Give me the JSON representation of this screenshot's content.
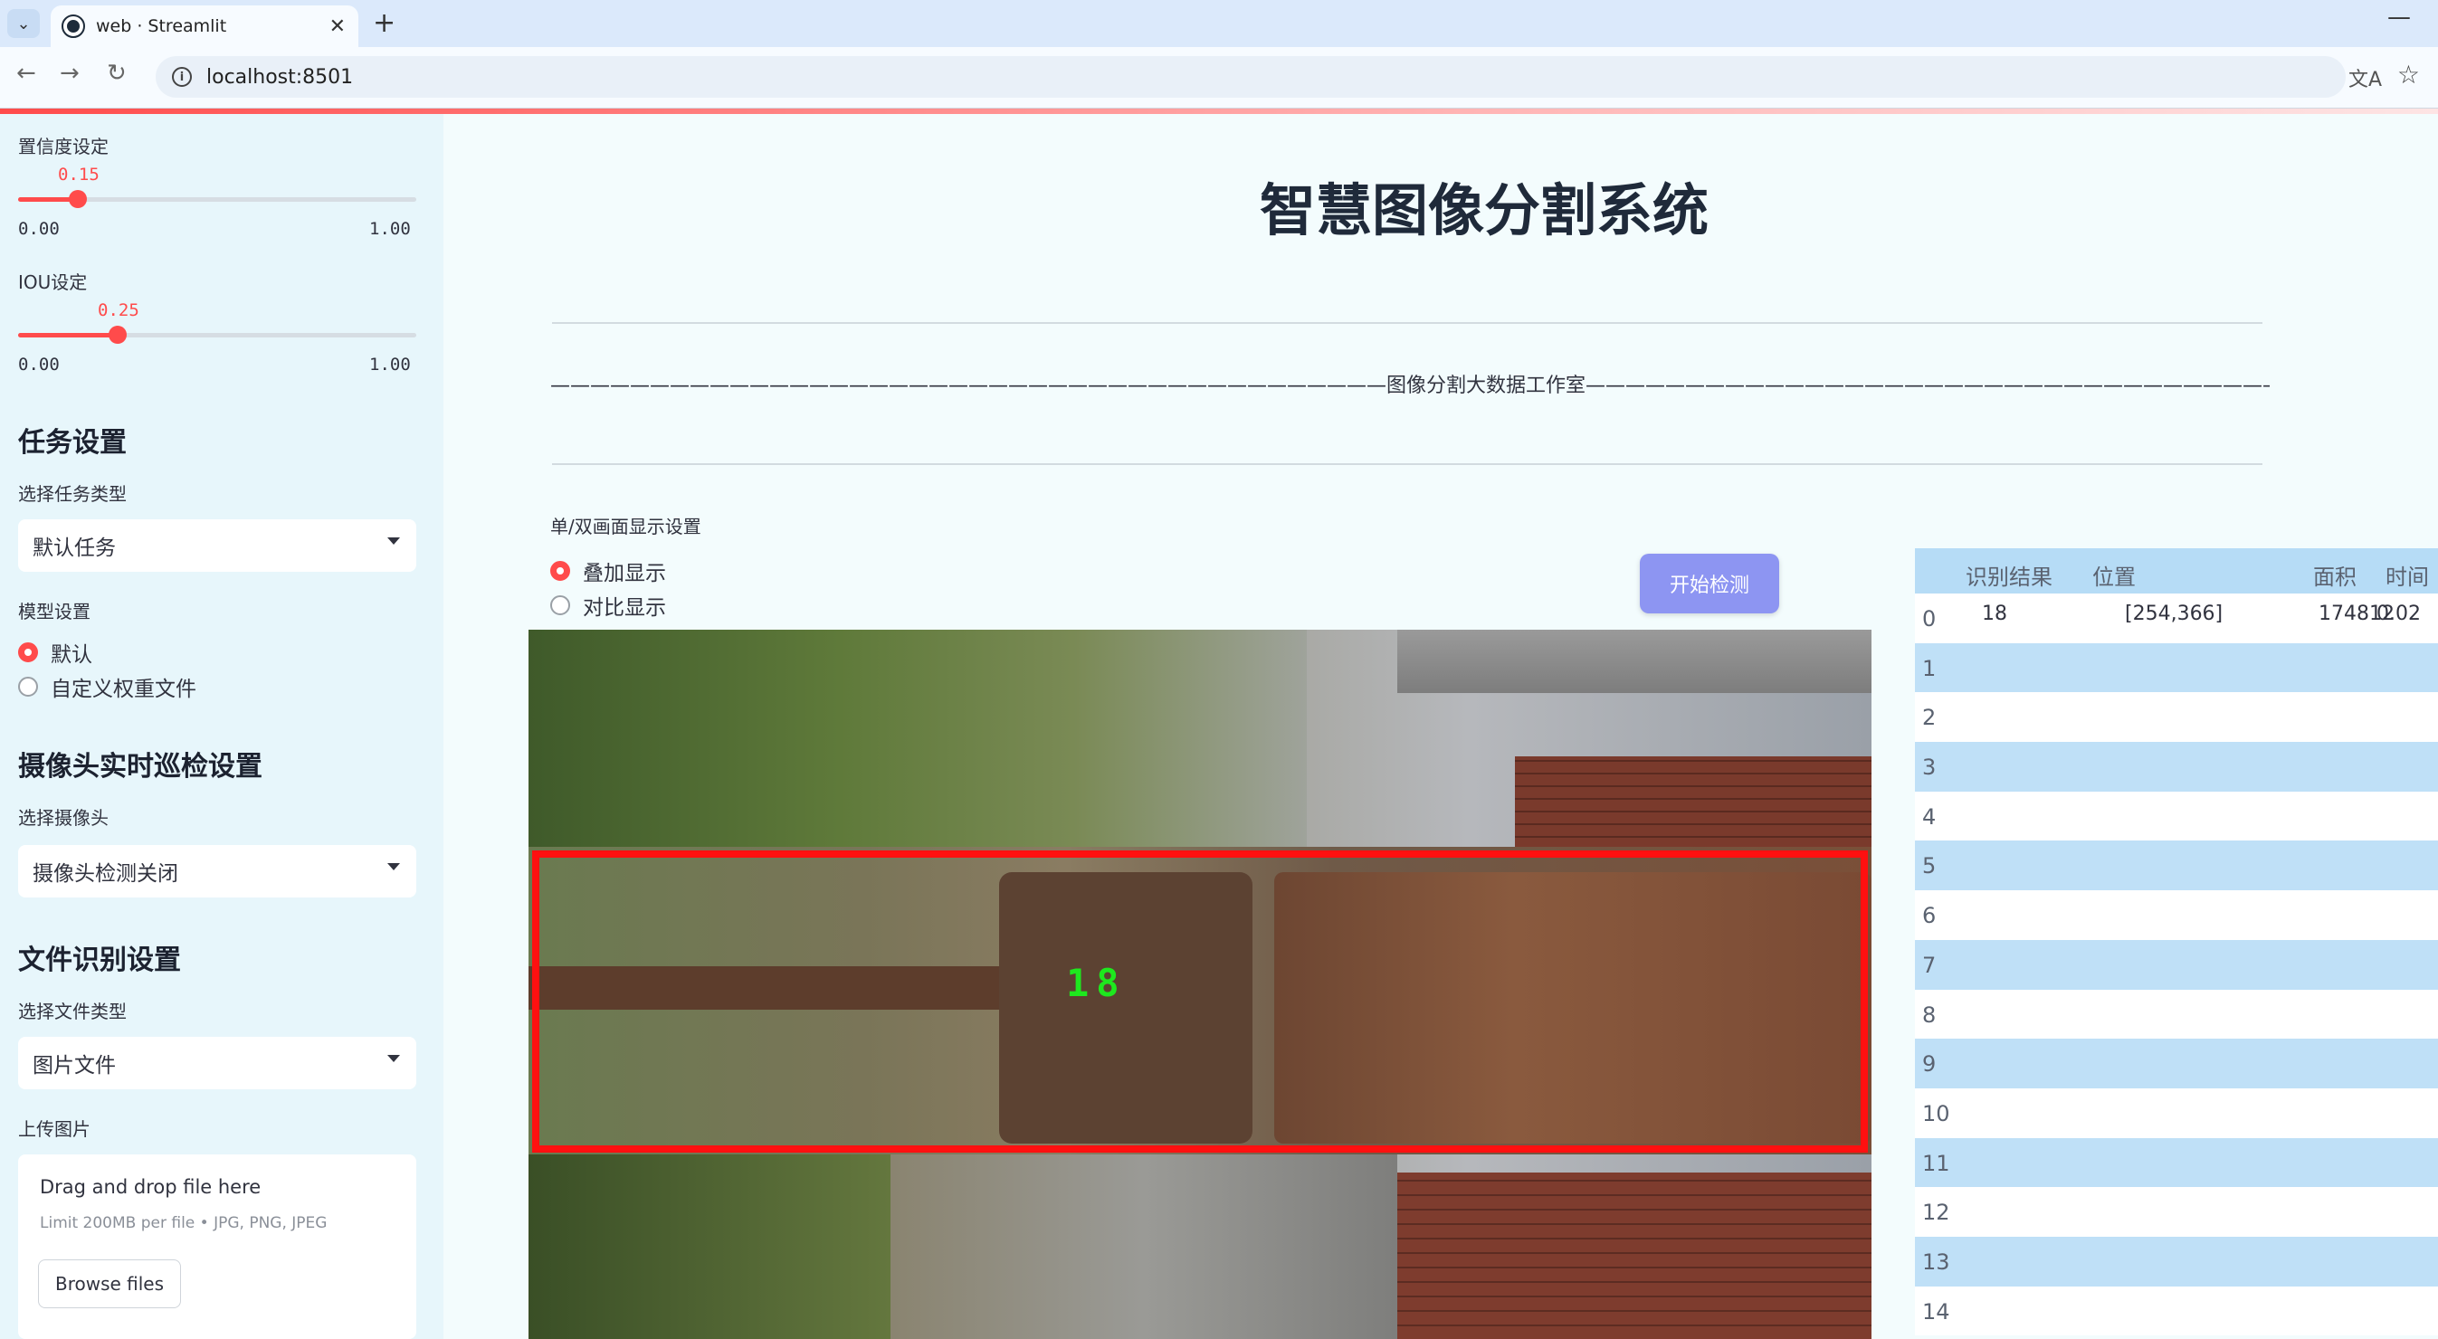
{
  "browser": {
    "tab_title": "web · Streamlit",
    "url": "localhost:8501"
  },
  "sidebar": {
    "confidence": {
      "label": "置信度设定",
      "value": "0.15",
      "fraction": 0.15,
      "min": "0.00",
      "max": "1.00"
    },
    "iou": {
      "label": "IOU设定",
      "value": "0.25",
      "fraction": 0.25,
      "min": "0.00",
      "max": "1.00"
    },
    "task_heading": "任务设置",
    "task_type_label": "选择任务类型",
    "task_type_value": "默认任务",
    "model_label": "模型设置",
    "model_options": [
      "默认",
      "自定义权重文件"
    ],
    "model_selected": "默认",
    "camera_heading": "摄像头实时巡检设置",
    "camera_label": "选择摄像头",
    "camera_value": "摄像头检测关闭",
    "file_heading": "文件识别设置",
    "file_type_label": "选择文件类型",
    "file_type_value": "图片文件",
    "upload_label": "上传图片",
    "upload_title": "Drag and drop file here",
    "upload_limit": "Limit 200MB per file • JPG, PNG, JPEG",
    "browse_label": "Browse files"
  },
  "main": {
    "title": "智慧图像分割系统",
    "divider_text": "——————————————————————————————————————————图像分割大数据工作室——————————————————————————————————————————",
    "display_mode_label": "单/双画面显示设置",
    "display_options": [
      "叠加显示",
      "对比显示"
    ],
    "display_selected": "叠加显示",
    "start_button": "开始检测",
    "detection_label": "18"
  },
  "results_table": {
    "columns": [
      "识别结果",
      "位置",
      "面积",
      "时间"
    ],
    "rows": [
      {
        "index": "0",
        "result": "18",
        "position": "[254,366]",
        "area": "174812",
        "time": "0.02"
      },
      {
        "index": "1"
      },
      {
        "index": "2"
      },
      {
        "index": "3"
      },
      {
        "index": "4"
      },
      {
        "index": "5"
      },
      {
        "index": "6"
      },
      {
        "index": "7"
      },
      {
        "index": "8"
      },
      {
        "index": "9"
      },
      {
        "index": "10"
      },
      {
        "index": "11"
      },
      {
        "index": "12"
      },
      {
        "index": "13"
      },
      {
        "index": "14"
      }
    ]
  },
  "colors": {
    "accent": "#ff4b4b",
    "button": "#8d95f2",
    "box": "#ff1010",
    "label": "#1ee81e"
  }
}
